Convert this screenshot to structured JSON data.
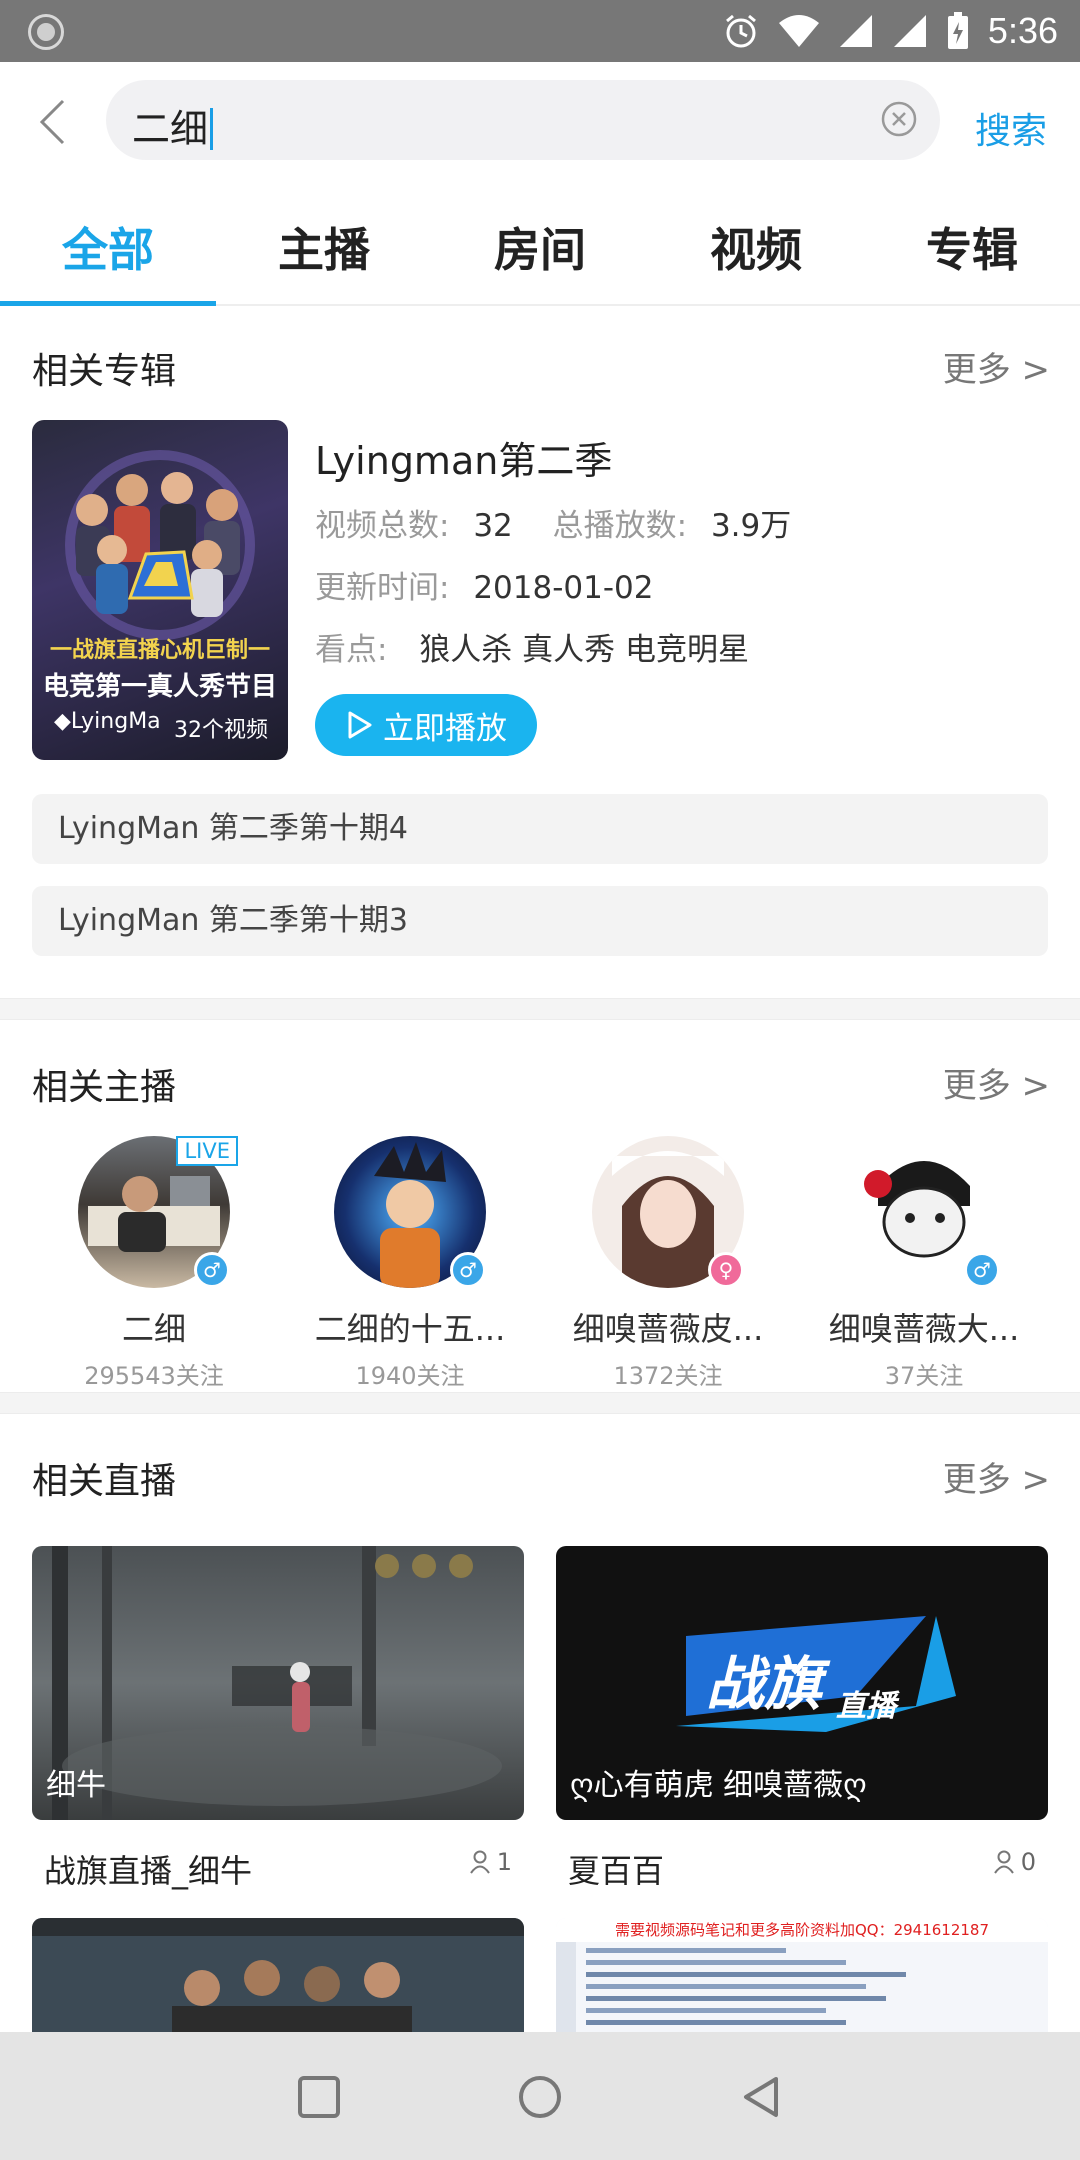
{
  "status_bar": {
    "time": "5:36"
  },
  "search": {
    "query": "二细",
    "submit_label": "搜索"
  },
  "tabs": [
    {
      "label": "全部",
      "active": true
    },
    {
      "label": "主播",
      "active": false
    },
    {
      "label": "房间",
      "active": false
    },
    {
      "label": "视频",
      "active": false
    },
    {
      "label": "专辑",
      "active": false
    }
  ],
  "albums_section": {
    "title": "相关专辑",
    "more": "更多 >",
    "album": {
      "cover_title_1": "一战旗直播心机巨制一",
      "cover_title_2": "电竞第一真人秀节目",
      "cover_name": "◆LyingMa",
      "cover_count": "32个视频",
      "title": "Lyingman第二季",
      "video_count_key": "视频总数:",
      "video_count": "32",
      "plays_key": "总播放数:",
      "plays": "3.9万",
      "updated_key": "更新时间:",
      "updated": "2018-01-02",
      "tags_key": "看点:",
      "tags": "狼人杀 真人秀 电竞明星",
      "play_label": "立即播放"
    },
    "episodes": [
      "LyingMan 第二季第十期4",
      "LyingMan 第二季第十期3"
    ]
  },
  "streamers_section": {
    "title": "相关主播",
    "more": "更多 >",
    "live_badge": "LIVE",
    "items": [
      {
        "name": "二细",
        "fans": "295543关注",
        "gender": "♂"
      },
      {
        "name": "二细的十五...",
        "fans": "1940关注",
        "gender": "♂"
      },
      {
        "name": "细嗅蔷薇皮...",
        "fans": "1372关注",
        "gender": "♀"
      },
      {
        "name": "细嗅蔷薇大...",
        "fans": "37关注",
        "gender": "♂"
      }
    ]
  },
  "live_section": {
    "title": "相关直播",
    "more": "更多 >",
    "items": [
      {
        "thumb_label": "细牛",
        "title": "战旗直播_细牛",
        "viewers": "1"
      },
      {
        "thumb_label": "ღ心有萌虎 细嗅蔷薇ღ",
        "title": "夏百百",
        "viewers": "0",
        "logo_text": "战旗",
        "logo_sub": "直播"
      }
    ],
    "partial_banner": "需要视频源码笔记和更多高阶资料加QQ：2941612187"
  },
  "colors": {
    "accent": "#1aa5e8",
    "play_button": "#1ab4ef",
    "male": "#3aa6e8",
    "female": "#f06a9a"
  }
}
